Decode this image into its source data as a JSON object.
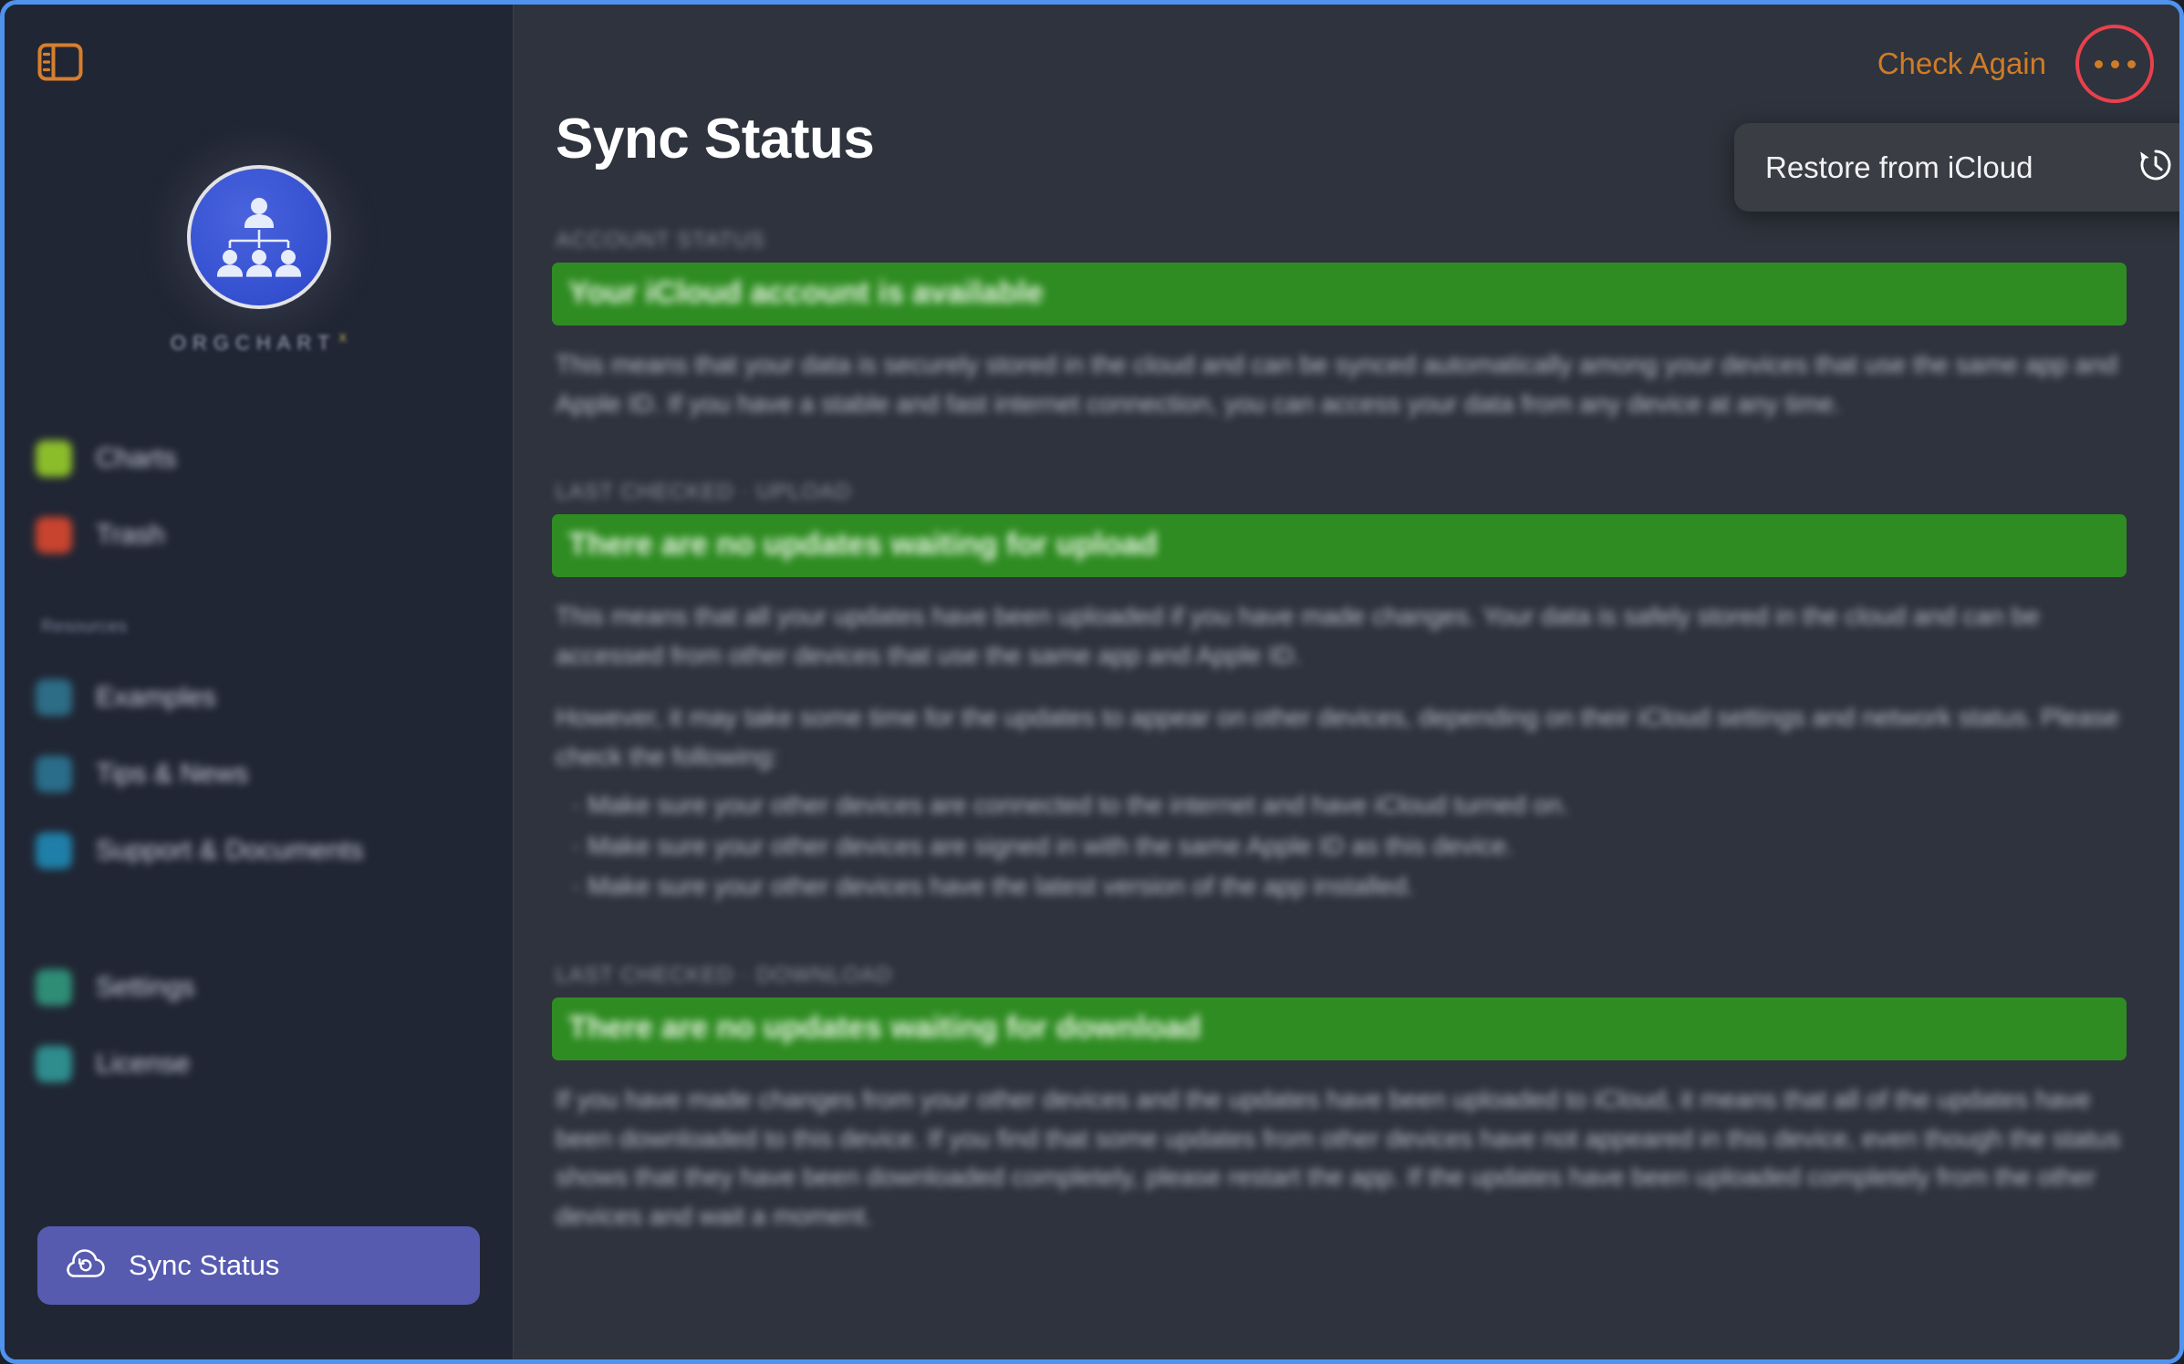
{
  "window": {
    "focus_border_color": "#4f93ef",
    "sidebar_bg": "#212634",
    "main_bg": "#2f333d"
  },
  "sidebar": {
    "toggle_icon": "sidebar-toggle-icon",
    "brand": {
      "logo_icon": "orgchart-logo-icon",
      "name": "ORGCHART",
      "superscript": "X"
    },
    "primary_items": [
      {
        "label": "Charts",
        "icon": "charts-icon",
        "icon_color": "#8bbd2b"
      },
      {
        "label": "Trash",
        "icon": "trash-icon",
        "icon_color": "#c8442f"
      }
    ],
    "resources_header": "Resources",
    "resource_items": [
      {
        "label": "Examples",
        "icon": "examples-icon",
        "icon_color": "#2d6d86"
      },
      {
        "label": "Tips & News",
        "icon": "tips-and-news-icon",
        "icon_color": "#2a6d8a"
      },
      {
        "label": "Support & Documents",
        "icon": "support-and-documents-icon",
        "icon_color": "#1f7fa8"
      }
    ],
    "system_items": [
      {
        "label": "Settings",
        "icon": "settings-icon",
        "icon_color": "#2f8d76"
      },
      {
        "label": "License",
        "icon": "license-icon",
        "icon_color": "#2f8d8d"
      }
    ],
    "selected_item": {
      "label": "Sync Status",
      "icon": "cloud-sync-icon",
      "background": "#565bb0"
    }
  },
  "toolbar": {
    "check_again_label": "Check Again",
    "check_again_color": "#cf7c26",
    "more_options_icon": "ellipsis-icon",
    "highlight_color": "#e8414c"
  },
  "menu": {
    "items": [
      {
        "label": "Restore from iCloud",
        "icon": "clock-history-icon"
      }
    ]
  },
  "main": {
    "page_title": "Sync Status",
    "sections": [
      {
        "meta": "ACCOUNT STATUS",
        "banner": "Your iCloud account is available",
        "banner_color": "#2f8c22",
        "paragraphs": [
          "This means that your data is securely stored in the cloud and can be synced automatically among your devices that use the same app and Apple ID. If you have a stable and fast internet connection, you can access your data from any device at any time."
        ],
        "list": []
      },
      {
        "meta": "LAST CHECKED · UPLOAD",
        "banner": "There are no updates waiting for upload",
        "banner_color": "#2f8c22",
        "paragraphs": [
          "This means that all your updates have been uploaded if you have made changes. Your data is safely stored in the cloud and can be accessed from other devices that use the same app and Apple ID.",
          "However, it may take some time for the updates to appear on other devices, depending on their iCloud settings and network status. Please check the following:"
        ],
        "list": [
          "· Make sure your other devices are connected to the internet and have iCloud turned on.",
          "· Make sure your other devices are signed in with the same Apple ID as this device.",
          "· Make sure your other devices have the latest version of the app installed."
        ]
      },
      {
        "meta": "LAST CHECKED · DOWNLOAD",
        "banner": "There are no updates waiting for download",
        "banner_color": "#2f8c22",
        "paragraphs": [
          "If you have made changes from your other devices and the updates have been uploaded to iCloud, it means that all of the updates have been downloaded to this device. If you find that some updates from other devices have not appeared in this device, even though the status shows that they have been downloaded completely, please restart the app. If the updates have been uploaded completely from the other devices and wait a moment."
        ],
        "list": []
      }
    ]
  }
}
